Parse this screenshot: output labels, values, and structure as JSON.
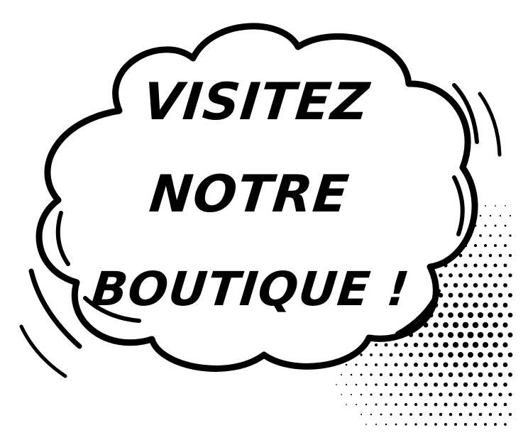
{
  "speech_bubble": {
    "lines": [
      "VISITEZ",
      "NOTRE",
      "BOUTIQUE !"
    ]
  },
  "colors": {
    "ink": "#000000",
    "paper": "#ffffff"
  },
  "icons": [
    "halftone-dots",
    "motion-lines",
    "cloud-speech-bubble"
  ]
}
